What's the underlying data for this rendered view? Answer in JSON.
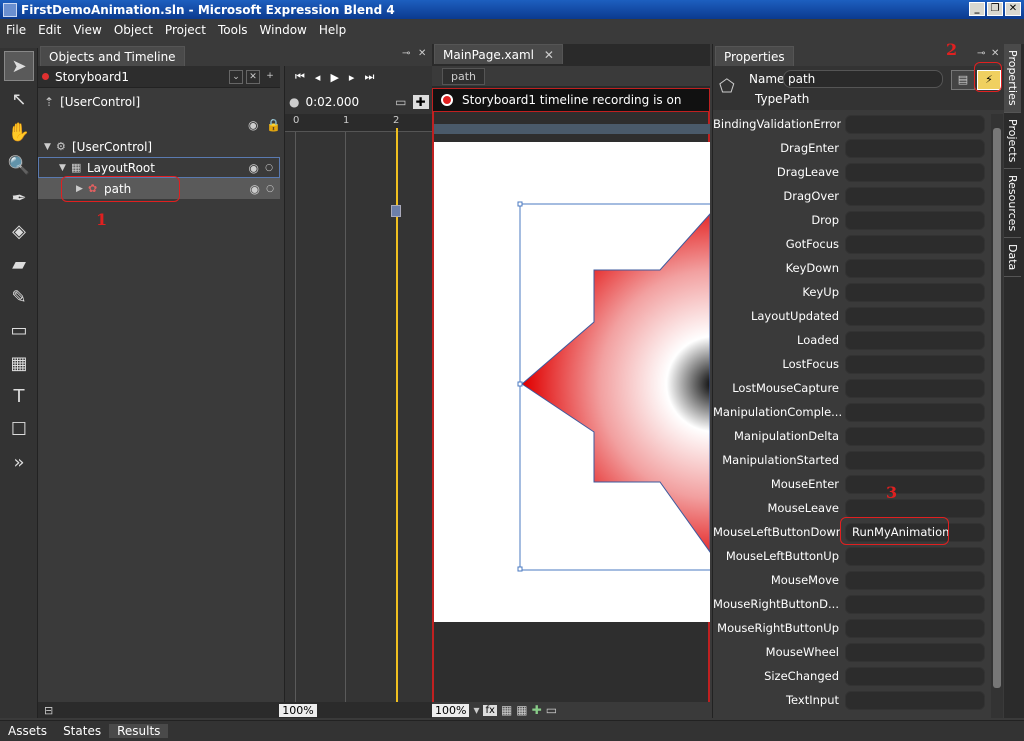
{
  "window": {
    "title": "FirstDemoAnimation.sln - Microsoft Expression Blend 4",
    "btn_min": "_",
    "btn_max": "❐",
    "btn_close": "✕"
  },
  "menu": [
    "File",
    "Edit",
    "View",
    "Object",
    "Project",
    "Tools",
    "Window",
    "Help"
  ],
  "objects_panel": {
    "tab": "Objects and Timeline",
    "storyboard": "Storyboard1",
    "scope": "[UserControl]",
    "tree": [
      {
        "label": "[UserControl]"
      },
      {
        "label": "LayoutRoot"
      },
      {
        "label": "path"
      }
    ]
  },
  "timeline": {
    "time": "0:02.000",
    "ruler": [
      "0",
      "1",
      "2"
    ],
    "zoom": "100%"
  },
  "document": {
    "tab": "MainPage.xaml",
    "breadcrumb": "path",
    "recording_message": "Storyboard1 timeline recording is on",
    "zoom": "100%"
  },
  "properties": {
    "tab": "Properties",
    "name_label": "Name",
    "name_value": "path",
    "type_label": "Type",
    "type_value": "Path",
    "events": [
      {
        "label": "BindingValidationError",
        "value": ""
      },
      {
        "label": "DragEnter",
        "value": ""
      },
      {
        "label": "DragLeave",
        "value": ""
      },
      {
        "label": "DragOver",
        "value": ""
      },
      {
        "label": "Drop",
        "value": ""
      },
      {
        "label": "GotFocus",
        "value": ""
      },
      {
        "label": "KeyDown",
        "value": ""
      },
      {
        "label": "KeyUp",
        "value": ""
      },
      {
        "label": "LayoutUpdated",
        "value": ""
      },
      {
        "label": "Loaded",
        "value": ""
      },
      {
        "label": "LostFocus",
        "value": ""
      },
      {
        "label": "LostMouseCapture",
        "value": ""
      },
      {
        "label": "ManipulationComple...",
        "value": ""
      },
      {
        "label": "ManipulationDelta",
        "value": ""
      },
      {
        "label": "ManipulationStarted",
        "value": ""
      },
      {
        "label": "MouseEnter",
        "value": ""
      },
      {
        "label": "MouseLeave",
        "value": ""
      },
      {
        "label": "MouseLeftButtonDown",
        "value": "RunMyAnimation"
      },
      {
        "label": "MouseLeftButtonUp",
        "value": ""
      },
      {
        "label": "MouseMove",
        "value": ""
      },
      {
        "label": "MouseRightButtonD...",
        "value": ""
      },
      {
        "label": "MouseRightButtonUp",
        "value": ""
      },
      {
        "label": "MouseWheel",
        "value": ""
      },
      {
        "label": "SizeChanged",
        "value": ""
      },
      {
        "label": "TextInput",
        "value": ""
      }
    ]
  },
  "side_tabs": [
    "Properties",
    "Projects",
    "Resources",
    "Data"
  ],
  "status_tabs": [
    "Assets",
    "States",
    "Results"
  ],
  "annotations": [
    "1",
    "2",
    "3"
  ],
  "colors": {
    "accent_red": "#e02020",
    "timeline_playhead": "#f0c020",
    "star_fill_edge": "#e02020"
  }
}
